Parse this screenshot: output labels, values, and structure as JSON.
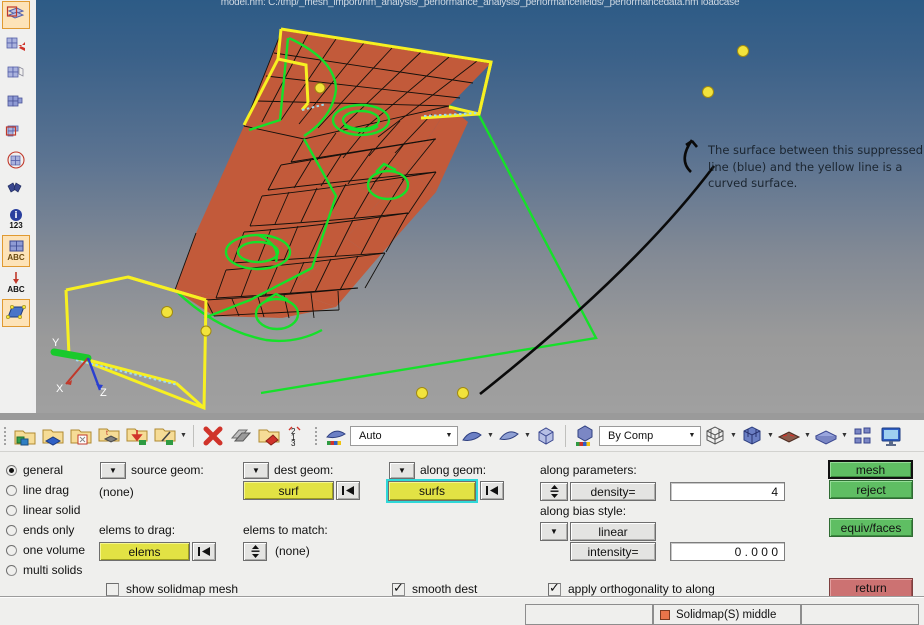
{
  "window": {
    "title": "model.hm: C:/tmp/_mesh_import/hm_analysis/_performance_analysis/_performancefields/_performancedata.hm  loadcase"
  },
  "viewport": {
    "annotation": "The surface between this suppressed line (blue) and the yellow line is a curved surface.",
    "axis_labels": {
      "x": "X",
      "y": "Y",
      "z": "Z"
    },
    "colors": {
      "mesh_fill": "#c25a3a",
      "mesh_line": "#14100c",
      "yellow_edge": "#f7f021",
      "green_edge": "#16e02a",
      "node_dot": "#f2e33c",
      "blue_dashed": "#8fd8f0",
      "bg_top": "#2d5b86",
      "bg_bottom": "#a0a0a0"
    }
  },
  "left_toolbar": {
    "items": [
      {
        "name": "mesh-edit-icon",
        "selected": true
      },
      {
        "name": "mesh-translate-icon",
        "selected": false
      },
      {
        "name": "mesh-grid-icon",
        "selected": false
      },
      {
        "name": "mesh-solid-icon",
        "selected": false
      },
      {
        "name": "mesh-select-icon",
        "selected": false
      },
      {
        "name": "mesh-circle-icon",
        "selected": false
      },
      {
        "name": "binoculars-icon",
        "selected": false
      },
      {
        "name": "info-number-icon",
        "selected": false,
        "caption": "123"
      },
      {
        "name": "label-abc-icon",
        "selected": true,
        "caption": "ABC"
      },
      {
        "name": "drop-abc-icon",
        "selected": false,
        "caption": "ABC"
      },
      {
        "name": "surface-node-icon",
        "selected": true
      }
    ]
  },
  "toolbar": {
    "groups": [
      {
        "buttons": [
          {
            "name": "components-icon",
            "arrow": false
          },
          {
            "name": "component-blue-icon",
            "arrow": false
          },
          {
            "name": "component-edit-icon",
            "arrow": false
          },
          {
            "name": "component-transform-icon",
            "arrow": false
          },
          {
            "name": "component-import-icon",
            "arrow": false
          },
          {
            "name": "component-tools-icon",
            "arrow": true
          }
        ]
      },
      {
        "buttons": [
          {
            "name": "delete-icon",
            "arrow": false
          },
          {
            "name": "mask-icon",
            "arrow": false
          },
          {
            "name": "component-color-icon",
            "arrow": false
          },
          {
            "name": "renumber-icon",
            "arrow": false,
            "caption": "123"
          }
        ]
      },
      {
        "combo": {
          "name": "display-mode-combo",
          "value": "Auto",
          "width": 108
        },
        "buttons": [
          {
            "name": "shaded-surface-icon",
            "arrow": true
          },
          {
            "name": "wireframe-surface-icon",
            "arrow": true
          },
          {
            "name": "shaded-geom-icon",
            "arrow": false
          }
        ]
      },
      {
        "combo": {
          "name": "color-by-combo",
          "value": "By Comp",
          "width": 102
        },
        "buttons": [
          {
            "name": "wireframe-cube-icon",
            "arrow": true
          },
          {
            "name": "shaded-cube-icon",
            "arrow": true
          },
          {
            "name": "element-fill-icon",
            "arrow": true
          },
          {
            "name": "solid-slab-icon",
            "arrow": true
          },
          {
            "name": "panels-icon",
            "arrow": false
          },
          {
            "name": "monitor-icon",
            "arrow": false
          }
        ]
      }
    ]
  },
  "panel": {
    "mode_radios": [
      {
        "label": "general",
        "selected": true
      },
      {
        "label": "line drag",
        "selected": false
      },
      {
        "label": "linear solid",
        "selected": false
      },
      {
        "label": "ends only",
        "selected": false
      },
      {
        "label": "one volume",
        "selected": false
      },
      {
        "label": "multi solids",
        "selected": false
      }
    ],
    "source_geom": {
      "label": "source geom:",
      "value": "(none)"
    },
    "dest_geom": {
      "label": "dest geom:",
      "value": "surf"
    },
    "along_geom": {
      "label": "along geom:",
      "value": "surfs"
    },
    "elems_to_drag": {
      "label": "elems to drag:",
      "value": "elems"
    },
    "elems_to_match": {
      "label": "elems to match:",
      "value": "(none)"
    },
    "along_parameters": {
      "header": "along parameters:",
      "density_label": "density=",
      "density_value": "4",
      "bias_header": "along bias style:",
      "bias_style": "linear",
      "intensity_label": "intensity=",
      "intensity_value": "0 . 0 0 0"
    },
    "checkboxes": [
      {
        "label": "show solidmap mesh",
        "checked": false
      },
      {
        "label": "smooth dest",
        "checked": true
      },
      {
        "label": "apply orthogonality to along",
        "checked": true
      }
    ],
    "actions": {
      "mesh": "mesh",
      "reject": "reject",
      "equiv_faces": "equiv/faces",
      "return": "return"
    }
  },
  "statusbar": {
    "component_label": "Solidmap(S)  middle"
  }
}
